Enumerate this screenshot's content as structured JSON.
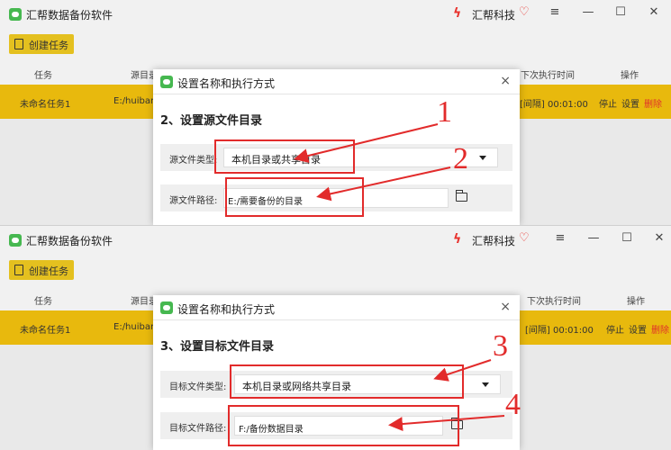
{
  "app": {
    "title": "汇帮数据备份软件",
    "brand": "汇帮科技",
    "create_button": "创建任务",
    "accent_color": "#e8b90d",
    "annotation_color": "#e22b2b"
  },
  "table": {
    "columns": [
      "任务",
      "源目录",
      "下次执行时间",
      "操作"
    ],
    "row": {
      "name": "未命名任务1",
      "source": "E:/huibang",
      "next_run": "[间隔] 00:01:00",
      "actions": [
        "停止",
        "设置",
        "删除"
      ]
    }
  },
  "dialog": {
    "title": "设置名称和执行方式"
  },
  "top": {
    "step_title": "2、设置源文件目录",
    "type_label": "源文件类型:",
    "type_value": "本机目录或共享目录",
    "path_label": "源文件路径:",
    "path_value": "E:/需要备份的目录",
    "marker_a": "1",
    "marker_b": "2"
  },
  "bottom": {
    "step_title": "3、设置目标文件目录",
    "type_label": "目标文件类型:",
    "type_value": "本机目录或网络共享目录",
    "path_label": "目标文件路径:",
    "path_value": "F:/备份数据目录",
    "marker_a": "3",
    "marker_b": "4"
  },
  "icons": {
    "window_controls": [
      "≡",
      "—",
      "☐",
      "✕"
    ],
    "close": "×",
    "brand_mark": "ϟ",
    "heart": "♡"
  }
}
